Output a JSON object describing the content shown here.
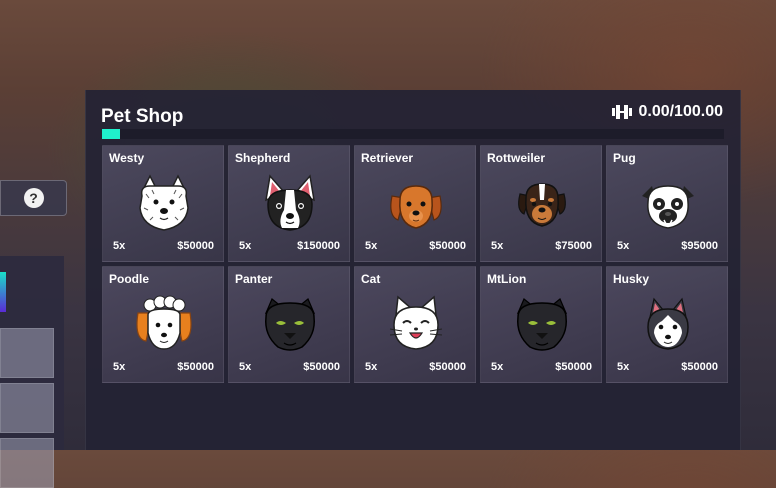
{
  "shop": {
    "title": "Pet Shop",
    "weight_text": "0.00/100.00",
    "weight_fraction": 0.0,
    "weight_icon": "weight-icon"
  },
  "help": {
    "label": "?"
  },
  "pets": [
    {
      "name": "Westy",
      "qty": "5x",
      "price": "$50000",
      "icon": "westy-icon"
    },
    {
      "name": "Shepherd",
      "qty": "5x",
      "price": "$150000",
      "icon": "shepherd-icon"
    },
    {
      "name": "Retriever",
      "qty": "5x",
      "price": "$50000",
      "icon": "retriever-icon"
    },
    {
      "name": "Rottweiler",
      "qty": "5x",
      "price": "$75000",
      "icon": "rottweiler-icon"
    },
    {
      "name": "Pug",
      "qty": "5x",
      "price": "$95000",
      "icon": "pug-icon"
    },
    {
      "name": "Poodle",
      "qty": "5x",
      "price": "$50000",
      "icon": "poodle-icon"
    },
    {
      "name": "Panter",
      "qty": "5x",
      "price": "$50000",
      "icon": "panther-icon"
    },
    {
      "name": "Cat",
      "qty": "5x",
      "price": "$50000",
      "icon": "cat-icon"
    },
    {
      "name": "MtLion",
      "qty": "5x",
      "price": "$50000",
      "icon": "mtlion-icon"
    },
    {
      "name": "Husky",
      "qty": "5x",
      "price": "$50000",
      "icon": "husky-icon"
    }
  ]
}
